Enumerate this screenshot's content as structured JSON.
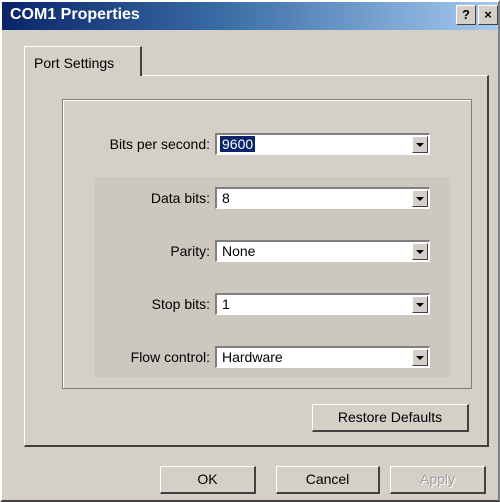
{
  "window": {
    "title": "COM1 Properties",
    "help_label": "?",
    "close_label": "×"
  },
  "tabs": [
    {
      "label": "Port Settings",
      "active": true
    }
  ],
  "settings": [
    {
      "label": "Bits per second:",
      "value": "9600",
      "selected": true
    },
    {
      "label": "Data bits:",
      "value": "8"
    },
    {
      "label": "Parity:",
      "value": "None"
    },
    {
      "label": "Stop bits:",
      "value": "1"
    },
    {
      "label": "Flow control:",
      "value": "Hardware"
    }
  ],
  "buttons": {
    "restore_defaults": "Restore Defaults",
    "ok": "OK",
    "cancel": "Cancel",
    "apply": "Apply"
  },
  "icons": {
    "dropdown": "chevron-down-icon",
    "help": "help-icon",
    "close": "close-icon"
  },
  "colors": {
    "titlebar_start": "#0a246a",
    "titlebar_end": "#a6caf0",
    "face": "#d4d0c8",
    "selection": "#0a246a"
  }
}
